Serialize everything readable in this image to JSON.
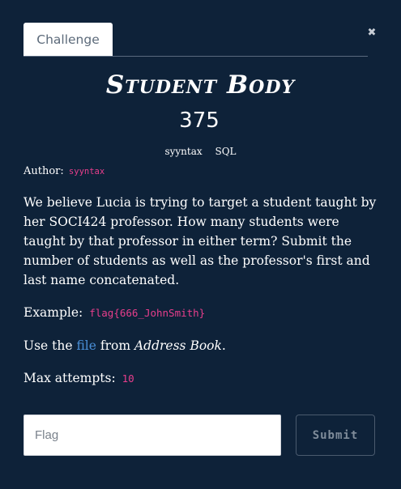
{
  "tabs": {
    "challenge_label": "Challenge"
  },
  "close_symbol": "✖",
  "challenge": {
    "name": "Student Body",
    "points": "375",
    "tags": [
      "syyntax",
      "SQL"
    ],
    "author_label": "Author:",
    "author": "syyntax",
    "description": "We believe Lucia is trying to target a student taught by her SOCI424 professor. How many students were taught by that professor in either term? Submit the number of students as well as the professor's first and last name concatenated.",
    "example_label": "Example:",
    "example_flag": "flag{666_JohnSmith}",
    "use_the": "Use the",
    "file_link": "file",
    "from": "from",
    "source_challenge": "Address Book",
    "period": ".",
    "max_attempts_label": "Max attempts:",
    "max_attempts": "10"
  },
  "form": {
    "flag_placeholder": "Flag",
    "submit_label": "Submit"
  },
  "colors": {
    "background": "#0e2239",
    "code_pink": "#e83e8c",
    "link_blue": "#4a90d9"
  }
}
